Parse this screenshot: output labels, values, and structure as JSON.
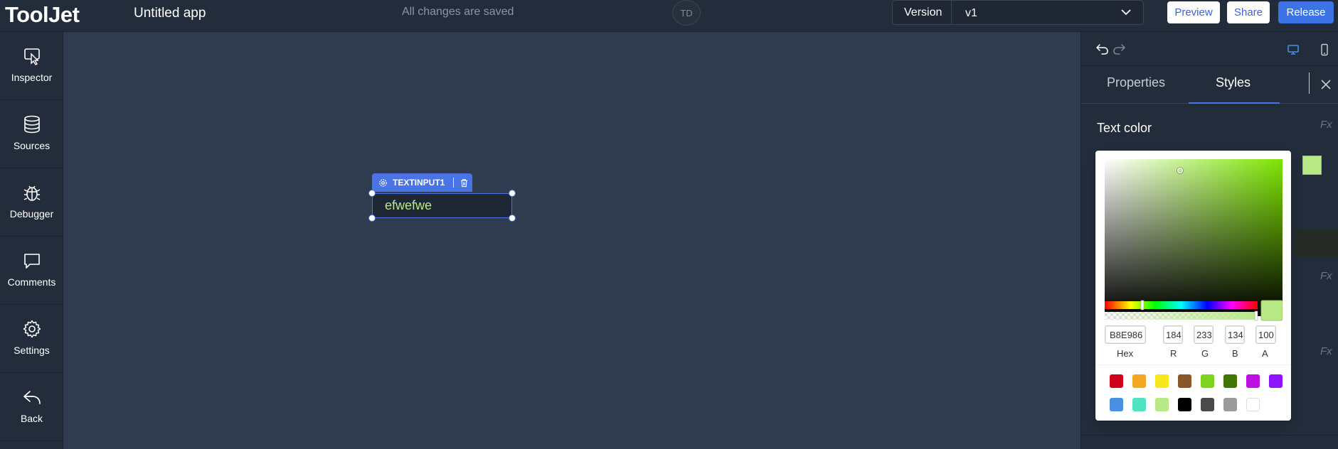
{
  "topbar": {
    "logo": "ToolJet",
    "app_name": "Untitled app",
    "save_status": "All changes are saved",
    "avatar_initials": "TD",
    "version_label": "Version",
    "version_value": "v1",
    "preview_label": "Preview",
    "share_label": "Share",
    "release_label": "Release"
  },
  "sidebar": {
    "items": [
      {
        "label": "Inspector",
        "icon": "inspector-icon"
      },
      {
        "label": "Sources",
        "icon": "database-icon"
      },
      {
        "label": "Debugger",
        "icon": "bug-icon"
      },
      {
        "label": "Comments",
        "icon": "comment-icon"
      },
      {
        "label": "Settings",
        "icon": "gear-icon"
      },
      {
        "label": "Back",
        "icon": "back-arrow-icon"
      }
    ]
  },
  "canvas": {
    "widget_name": "TEXTINPUT1",
    "widget_value": "efwefwe"
  },
  "right_panel": {
    "tab_properties": "Properties",
    "tab_styles": "Styles",
    "section_title": "Text color",
    "fx_label": "Fx",
    "selected_color": "#b8e986"
  },
  "color_picker": {
    "hex_value": "B8E986",
    "r_value": "184",
    "g_value": "233",
    "b_value": "134",
    "a_value": "100",
    "hex_label": "Hex",
    "r_label": "R",
    "g_label": "G",
    "b_label": "B",
    "a_label": "A",
    "presets": [
      "#d0021b",
      "#f5a623",
      "#f8e71c",
      "#8b572a",
      "#7ed321",
      "#417505",
      "#bd10e0",
      "#9013fe",
      "#4a90e2",
      "#50e3c2",
      "#b8e986",
      "#000000",
      "#4a4a4a",
      "#9b9b9b",
      "#ffffff"
    ]
  }
}
